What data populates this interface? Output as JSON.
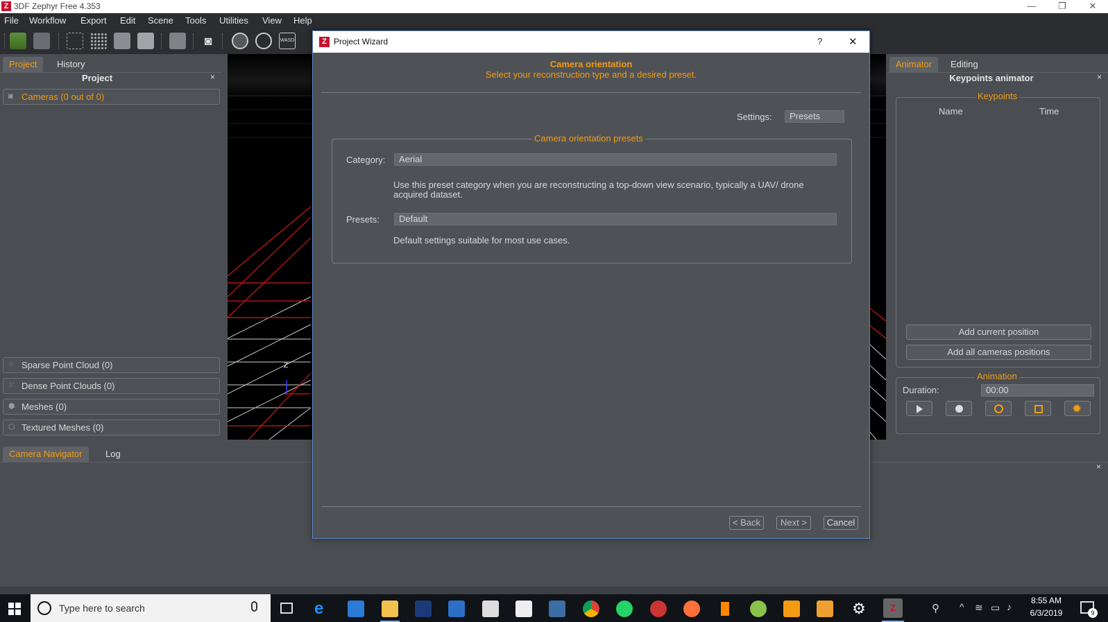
{
  "window": {
    "title": "3DF Zephyr Free 4.353",
    "logo": "Z"
  },
  "menu": [
    "File",
    "Workflow",
    "Export",
    "Edit",
    "Scene",
    "Tools",
    "Utilities",
    "View",
    "Help"
  ],
  "left_panel": {
    "tabs": [
      "Project",
      "History"
    ],
    "title": "Project",
    "close": "×",
    "cameras": "Cameras (0 out of 0)",
    "items": [
      "Sparse Point Cloud (0)",
      "Dense Point Clouds (0)",
      "Meshes (0)",
      "Textured Meshes (0)"
    ]
  },
  "right_panel": {
    "tabs": [
      "Animator",
      "Editing"
    ],
    "title": "Keypoints animator",
    "close": "×",
    "keypoints_legend": "Keypoints",
    "columns": [
      "Name",
      "Time"
    ],
    "add_current": "Add current position",
    "add_all": "Add all cameras positions",
    "animation_legend": "Animation",
    "duration_label": "Duration:",
    "duration_value": "00:00"
  },
  "bottom_panel": {
    "tabs": [
      "Camera Navigator",
      "Log"
    ],
    "close": "×"
  },
  "viewport": {
    "axis_label": "Z"
  },
  "dialog": {
    "title": "Project Wizard",
    "help": "?",
    "close": "✕",
    "heading": "Camera orientation",
    "subheading": "Select your reconstruction type and a desired preset.",
    "settings_label": "Settings:",
    "settings_value": "Presets",
    "group_legend": "Camera orientation presets",
    "category_label": "Category:",
    "category_value": "Aerial",
    "category_desc": "Use this preset category when you are reconstructing a top-down view scenario, typically a UAV/ drone acquired dataset.",
    "presets_label": "Presets:",
    "presets_value": "Default",
    "presets_desc": "Default settings suitable for most use cases.",
    "back": "< Back",
    "next": "Next >",
    "cancel": "Cancel"
  },
  "taskbar": {
    "search_placeholder": "Type here to search",
    "time": "8:55 AM",
    "date": "6/3/2019",
    "notifications": "9"
  },
  "colors": {
    "accent": "#f39c12",
    "panel": "#4a4d51",
    "dark": "#2b2d30",
    "brand_red": "#c8102e"
  }
}
